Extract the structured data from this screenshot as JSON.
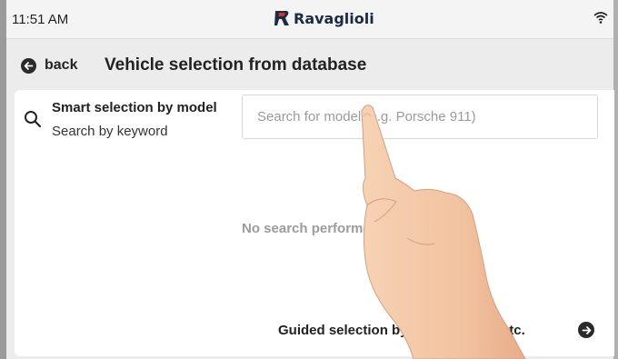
{
  "status_bar": {
    "time": "11:51 AM",
    "brand": "Ravaglioli",
    "wifi_icon": "wifi-icon"
  },
  "header": {
    "back_label": "back",
    "title": "Vehicle selection from database"
  },
  "smart_selection": {
    "title": "Smart selection by model",
    "subtitle": "Search by keyword",
    "search_placeholder": "Search for model (e.g. Porsche 911)",
    "search_value": "",
    "icon": "search-icon"
  },
  "results": {
    "empty_message": "No search performed"
  },
  "guided_selection": {
    "label": "Guided selection by make, model, etc.",
    "icon": "arrow-right-circle-icon"
  },
  "colors": {
    "background": "#ececec",
    "card": "#ffffff",
    "text": "#222222",
    "placeholder": "#9a9a9a",
    "brand_red": "#d0322c",
    "brand_blue": "#1d2a44"
  }
}
